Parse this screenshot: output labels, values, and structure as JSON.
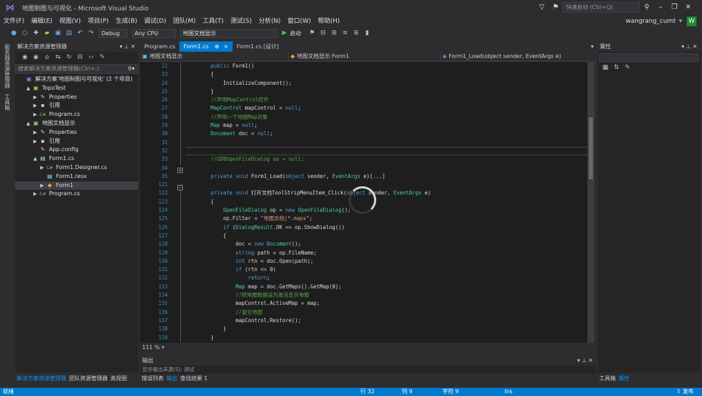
{
  "window": {
    "title": "地图制图与可视化 - Microsoft Visual Studio",
    "quick_launch": "快速启动 (Ctrl+Q)",
    "account": "wangrang_cumt",
    "account_badge": "W"
  },
  "menu": [
    "文件(F)",
    "编辑(E)",
    "视图(V)",
    "项目(P)",
    "生成(B)",
    "调试(D)",
    "团队(M)",
    "工具(T)",
    "测试(S)",
    "分析(N)",
    "窗口(W)",
    "帮助(H)"
  ],
  "toolbar": {
    "config": "Debug",
    "platform": "Any CPU",
    "startup_project": "地图文档显示",
    "start_label": "启动"
  },
  "left_vertical_tabs": [
    "服务器资源管理器",
    "工具箱"
  ],
  "solution_explorer": {
    "title": "解决方案资源管理器",
    "search_placeholder": "搜索解决方案资源管理器(Ctrl+;)",
    "items": [
      {
        "label": "解决方案'地图制图与可视化' (2 个项目)",
        "icon": "solution-icon",
        "indent": 0,
        "arrow": ""
      },
      {
        "label": "TopoTest",
        "icon": "csharp-project-icon",
        "indent": 1,
        "arrow": "▲"
      },
      {
        "label": "Properties",
        "icon": "wrench-icon",
        "indent": 2,
        "arrow": "▶"
      },
      {
        "label": "引用",
        "icon": "references-icon",
        "indent": 2,
        "arrow": "▶"
      },
      {
        "label": "Program.cs",
        "icon": "cs-file-icon",
        "indent": 2,
        "arrow": "▶"
      },
      {
        "label": "地图文档显示",
        "icon": "csharp-project-icon",
        "indent": 1,
        "arrow": "▲"
      },
      {
        "label": "Properties",
        "icon": "wrench-icon",
        "indent": 2,
        "arrow": "▶"
      },
      {
        "label": "引用",
        "icon": "references-icon",
        "indent": 2,
        "arrow": "▶"
      },
      {
        "label": "App.config",
        "icon": "config-file-icon",
        "indent": 2,
        "arrow": ""
      },
      {
        "label": "Form1.cs",
        "icon": "form-file-icon",
        "indent": 2,
        "arrow": "▲"
      },
      {
        "label": "Form1.Designer.cs",
        "icon": "cs-file-icon",
        "indent": 3,
        "arrow": "▶"
      },
      {
        "label": "Form1.resx",
        "icon": "resx-file-icon",
        "indent": 3,
        "arrow": ""
      },
      {
        "label": "Form1",
        "icon": "class-icon",
        "indent": 3,
        "arrow": "▶",
        "selected": true
      },
      {
        "label": "Program.cs",
        "icon": "cs-file-icon",
        "indent": 2,
        "arrow": "▶"
      }
    ],
    "bottom_tabs": [
      "解决方案资源管理器",
      "团队资源管理器",
      "类视图"
    ]
  },
  "editor": {
    "tabs": [
      {
        "label": "Program.cs",
        "active": false
      },
      {
        "label": "Form1.cs",
        "active": true,
        "pin": "⊕",
        "close": "×"
      },
      {
        "label": "Form1.cs [设计]",
        "active": false
      }
    ],
    "nav": {
      "project": "地图文档显示",
      "class": "地图文档显示.Form1",
      "member": "Form1_Load(object sender, EventArgs e)"
    },
    "zoom": "111 %",
    "lines": [
      {
        "n": "22",
        "code": [
          [
            "",
            "        "
          ],
          [
            "kw",
            "public"
          ],
          [
            "",
            " Form1()"
          ]
        ]
      },
      {
        "n": "23",
        "code": [
          [
            "",
            "        {"
          ]
        ]
      },
      {
        "n": "24",
        "code": [
          [
            "",
            "            InitializeComponent();"
          ]
        ]
      },
      {
        "n": "25",
        "code": [
          [
            "",
            "        }"
          ]
        ]
      },
      {
        "n": "26",
        "code": [
          [
            "",
            "        "
          ],
          [
            "cm",
            "//声明MapControl控件"
          ]
        ]
      },
      {
        "n": "27",
        "code": [
          [
            "",
            "        "
          ],
          [
            "ty",
            "MapControl"
          ],
          [
            "",
            " mapControl = "
          ],
          [
            "kw",
            "null"
          ],
          [
            "",
            ";"
          ]
        ]
      },
      {
        "n": "28",
        "code": [
          [
            "",
            "        "
          ],
          [
            "cm",
            "//声明一个地图Map对象"
          ]
        ]
      },
      {
        "n": "29",
        "code": [
          [
            "",
            "        "
          ],
          [
            "ty",
            "Map"
          ],
          [
            "",
            " map = "
          ],
          [
            "kw",
            "null"
          ],
          [
            "",
            ";"
          ]
        ]
      },
      {
        "n": "30",
        "code": [
          [
            "",
            "        "
          ],
          [
            "ty",
            "Document"
          ],
          [
            "",
            " doc = "
          ],
          [
            "kw",
            "null"
          ],
          [
            "",
            ";"
          ]
        ]
      },
      {
        "n": "31",
        "code": [
          [
            "",
            ""
          ]
        ]
      },
      {
        "n": "32",
        "code": [
          [
            "",
            ""
          ]
        ],
        "current": true
      },
      {
        "n": "33",
        "code": [
          [
            "",
            "        "
          ],
          [
            "cm",
            "//GDBOpenFileDialog op = null;"
          ]
        ]
      },
      {
        "n": "34",
        "code": [
          [
            "",
            ""
          ]
        ]
      },
      {
        "n": "35",
        "code": [
          [
            "",
            "        "
          ],
          [
            "kw",
            "private"
          ],
          [
            "",
            " "
          ],
          [
            "kw",
            "void"
          ],
          [
            "",
            " Form1_Load("
          ],
          [
            "kw",
            "object"
          ],
          [
            "",
            " sender, "
          ],
          [
            "ty",
            "EventArgs"
          ],
          [
            "",
            " e)[...]"
          ]
        ]
      },
      {
        "n": "121",
        "code": [
          [
            "",
            ""
          ]
        ]
      },
      {
        "n": "122",
        "code": [
          [
            "",
            "        "
          ],
          [
            "kw",
            "private"
          ],
          [
            "",
            " "
          ],
          [
            "kw",
            "void"
          ],
          [
            "",
            " 打开文档ToolStripMenuItem_Click("
          ],
          [
            "kw",
            "object"
          ],
          [
            "",
            " sender, "
          ],
          [
            "ty",
            "EventArgs"
          ],
          [
            "",
            " e)"
          ]
        ]
      },
      {
        "n": "123",
        "code": [
          [
            "",
            "        {"
          ]
        ]
      },
      {
        "n": "124",
        "code": [
          [
            "",
            "            "
          ],
          [
            "ty",
            "OpenFileDialog"
          ],
          [
            "",
            " op = "
          ],
          [
            "kw",
            "new"
          ],
          [
            "",
            " "
          ],
          [
            "ty",
            "OpenFileDialog"
          ],
          [
            "",
            "();"
          ]
        ]
      },
      {
        "n": "125",
        "code": [
          [
            "",
            "            op.Filter = "
          ],
          [
            "st",
            "\"地图文档|*.mapx\""
          ],
          [
            "",
            ";"
          ]
        ]
      },
      {
        "n": "126",
        "code": [
          [
            "",
            "            "
          ],
          [
            "kw",
            "if"
          ],
          [
            "",
            " ("
          ],
          [
            "ty",
            "DialogResult"
          ],
          [
            "",
            ".OK == op.ShowDialog())"
          ]
        ]
      },
      {
        "n": "127",
        "code": [
          [
            "",
            "            {"
          ]
        ]
      },
      {
        "n": "128",
        "code": [
          [
            "",
            "                doc = "
          ],
          [
            "kw",
            "new"
          ],
          [
            "",
            " "
          ],
          [
            "ty",
            "Document"
          ],
          [
            "",
            "();"
          ]
        ]
      },
      {
        "n": "129",
        "code": [
          [
            "",
            "                "
          ],
          [
            "kw",
            "string"
          ],
          [
            "",
            " path = op.FileName;"
          ]
        ]
      },
      {
        "n": "130",
        "code": [
          [
            "",
            "                "
          ],
          [
            "kw",
            "int"
          ],
          [
            "",
            " rtn = doc.Open(path);"
          ]
        ]
      },
      {
        "n": "131",
        "code": [
          [
            "",
            "                "
          ],
          [
            "kw",
            "if"
          ],
          [
            "",
            " (rtn <= 0)"
          ]
        ]
      },
      {
        "n": "132",
        "code": [
          [
            "",
            "                    "
          ],
          [
            "kw",
            "return"
          ],
          [
            "",
            ";"
          ]
        ]
      },
      {
        "n": "133",
        "code": [
          [
            "",
            "                "
          ],
          [
            "ty",
            "Map"
          ],
          [
            "",
            " map = doc.GetMaps().GetMap(0);"
          ]
        ]
      },
      {
        "n": "134",
        "code": [
          [
            "",
            "                "
          ],
          [
            "cm",
            "//把地图数据设为激活显示地图"
          ]
        ]
      },
      {
        "n": "135",
        "code": [
          [
            "",
            "                mapControl.ActiveMap = map;"
          ]
        ]
      },
      {
        "n": "136",
        "code": [
          [
            "",
            "                "
          ],
          [
            "cm",
            "//复位地图"
          ]
        ]
      },
      {
        "n": "137",
        "code": [
          [
            "",
            "                mapControl.Restore();"
          ]
        ]
      },
      {
        "n": "138",
        "code": [
          [
            "",
            "            }"
          ]
        ]
      },
      {
        "n": "139",
        "code": [
          [
            "",
            "        }"
          ]
        ]
      },
      {
        "n": "140",
        "code": [
          [
            "",
            ""
          ]
        ]
      }
    ]
  },
  "output": {
    "title": "输出",
    "show_from": "显示输出来源(S): 调试",
    "bottom_tabs": [
      "错误列表",
      "输出",
      "查找结果 1"
    ]
  },
  "properties": {
    "title": "属性",
    "bottom_tabs": [
      "工具箱",
      "属性"
    ]
  },
  "status": {
    "ready": "就绪",
    "line": "行 32",
    "col": "列 9",
    "char": "字符 9",
    "mode": "Ins",
    "publish": "发布"
  }
}
